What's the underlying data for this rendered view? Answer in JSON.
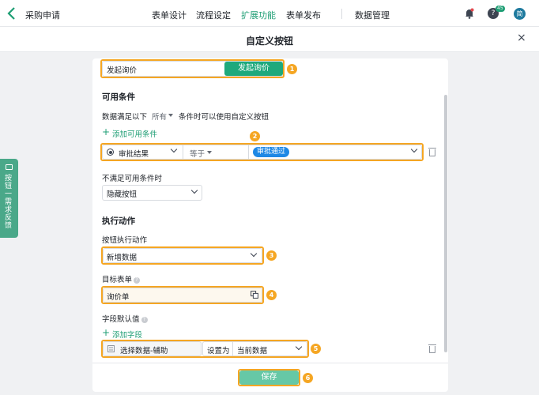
{
  "topbar": {
    "app_title": "采购申请",
    "nav": [
      "表单设计",
      "流程设定",
      "扩展功能",
      "表单发布",
      "数据管理"
    ],
    "help_badge": "45",
    "avatar_text": "简"
  },
  "modal": {
    "title": "自定义按钮",
    "close": "×"
  },
  "side_tab": {
    "label": "按钮一需求反馈"
  },
  "button_row": {
    "name_value": "发起询价",
    "preview_label": "发起询价"
  },
  "conditions": {
    "heading": "可用条件",
    "rule_prefix": "数据满足以下",
    "rule_mode": "所有",
    "rule_suffix": "条件时可以使用自定义按钮",
    "add_label": "添加可用条件",
    "row": {
      "field": "审批结果",
      "operator": "等于",
      "value_tag": "审批通过"
    },
    "unmet_label": "不满足可用条件时",
    "unmet_value": "隐藏按钮"
  },
  "action": {
    "heading": "执行动作",
    "action_label": "按钮执行动作",
    "action_value": "新增数据",
    "target_label": "目标表单",
    "target_value": "询价单",
    "defaults_label": "字段默认值",
    "add_field_label": "添加字段",
    "field_row": {
      "field": "选择数据-辅助",
      "set_as": "设置为",
      "value": "当前数据"
    }
  },
  "footer": {
    "save_label": "保存"
  },
  "markers": [
    "1",
    "2",
    "3",
    "4",
    "5",
    "6"
  ],
  "colors": {
    "accent": "#1e9e74",
    "highlight": "#f5a623",
    "tag_blue": "#1e88e5"
  }
}
